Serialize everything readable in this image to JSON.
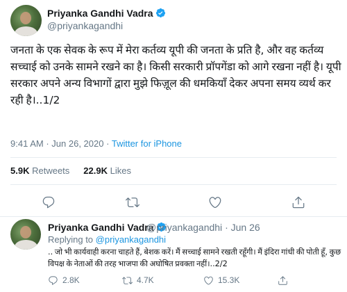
{
  "main_tweet": {
    "author_name": "Priyanka Gandhi Vadra",
    "author_handle": "@priyankagandhi",
    "text": "जनता के एक सेवक के रूप में मेरा कर्तव्य यूपी की जनता के प्रति है, और वह कर्तव्य सच्चाई को उनके सामने रखने का है। किसी सरकारी प्रॉपगेंडा को आगे रखना नहीं है। यूपी सरकार अपने अन्य विभागों द्वारा मुझे फिज़ूल की धमकियाँ देकर अपना समय व्यर्थ कर रही है।..1/2",
    "time": "9:41 AM",
    "date": "Jun 26, 2020",
    "separator": "·",
    "source": "Twitter for iPhone",
    "retweets_count": "5.9K",
    "retweets_label": "Retweets",
    "likes_count": "22.9K",
    "likes_label": "Likes",
    "actions": [
      "reply-icon",
      "retweet-icon",
      "like-icon",
      "share-icon"
    ]
  },
  "reply_tweet": {
    "author_name": "Priyanka Gandhi Vadra",
    "author_handle": "@priyankagandhi",
    "separator": "·",
    "date": "Jun 26",
    "replying_label": "Replying to",
    "replying_handle": "@priyankagandhi",
    "text": ".. जो भी कार्यवाही करना चाहते हैं, बेशक करें। मैं सच्चाई सामने रखती रहूँगी। मैं इंदिरा गांधी की पोती हूँ, कुछ विपक्ष के नेताओं की तरह भाजपा की अघोषित प्रवक्ता नहीं।..2/2",
    "replies_count": "2.8K",
    "retweets_count": "4.7K",
    "likes_count": "15.3K"
  },
  "colors": {
    "text": "#14171a",
    "secondary": "#657786",
    "link": "#1b95e0",
    "verified": "#1da1f2",
    "divider": "#e6ecf0"
  }
}
